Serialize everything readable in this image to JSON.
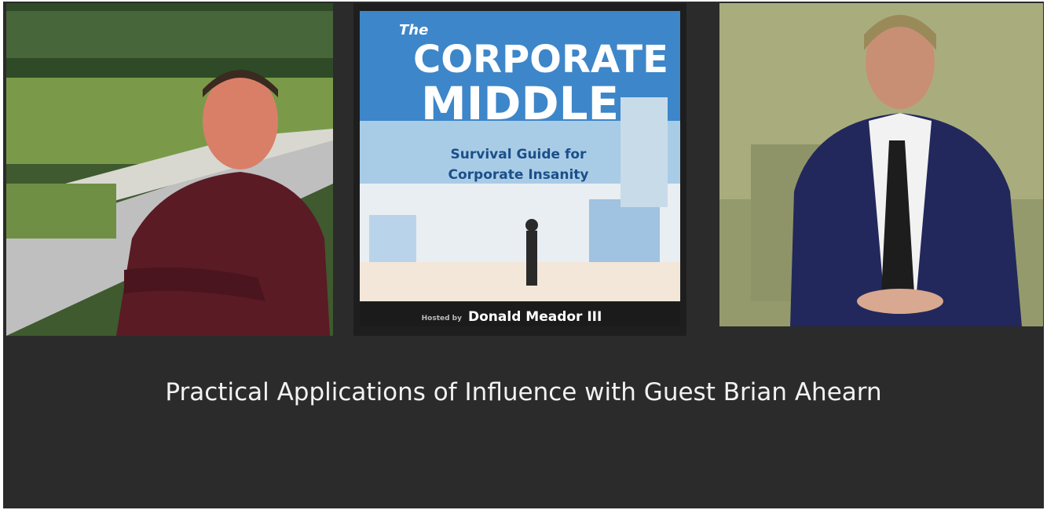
{
  "cover": {
    "the": "The",
    "title_line1": "CORPORATE",
    "title_line2": "MIDDLE",
    "subtitle_line1": "Survival Guide for",
    "subtitle_line2": "Corporate Insanity",
    "hosted_by": "Hosted by",
    "host_name": "Donald Meador III"
  },
  "caption": "Practical Applications of Influence with Guest Brian Ahearn",
  "colors": {
    "background": "#2b2b2b",
    "caption_text": "#f2f2f2",
    "cover_blue": "#3d86c9",
    "cover_title": "#ffffff",
    "cover_subtitle": "#1b4f8a"
  }
}
